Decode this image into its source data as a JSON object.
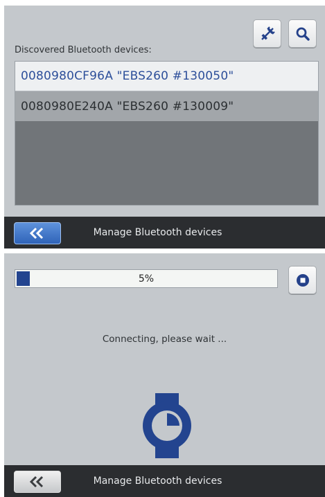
{
  "screen1": {
    "section_label": "Discovered Bluetooth devices:",
    "devices": [
      {
        "label": "0080980CF96A \"EBS260 #130050\"",
        "selected": true
      },
      {
        "label": "0080980E240A \"EBS260 #130009\"",
        "selected": false
      }
    ],
    "toolbar": {
      "connect_icon": "plug-connect-icon",
      "search_icon": "magnifier-icon"
    },
    "bottom_bar": {
      "back_icon": "double-chevron-left-icon",
      "title": "Manage Bluetooth devices"
    }
  },
  "screen2": {
    "progress": {
      "percent": 5,
      "label": "5%"
    },
    "stop_icon": "stop-icon",
    "status": "Connecting, please wait ...",
    "device_icon": "watch-icon",
    "bottom_bar": {
      "back_icon": "double-chevron-left-icon",
      "title": "Manage Bluetooth devices"
    }
  },
  "colors": {
    "accent": "#23448f",
    "selected_text": "#2d4f9a",
    "screen_bg": "#c4c8cc",
    "bar_bg": "#2b2d30"
  }
}
